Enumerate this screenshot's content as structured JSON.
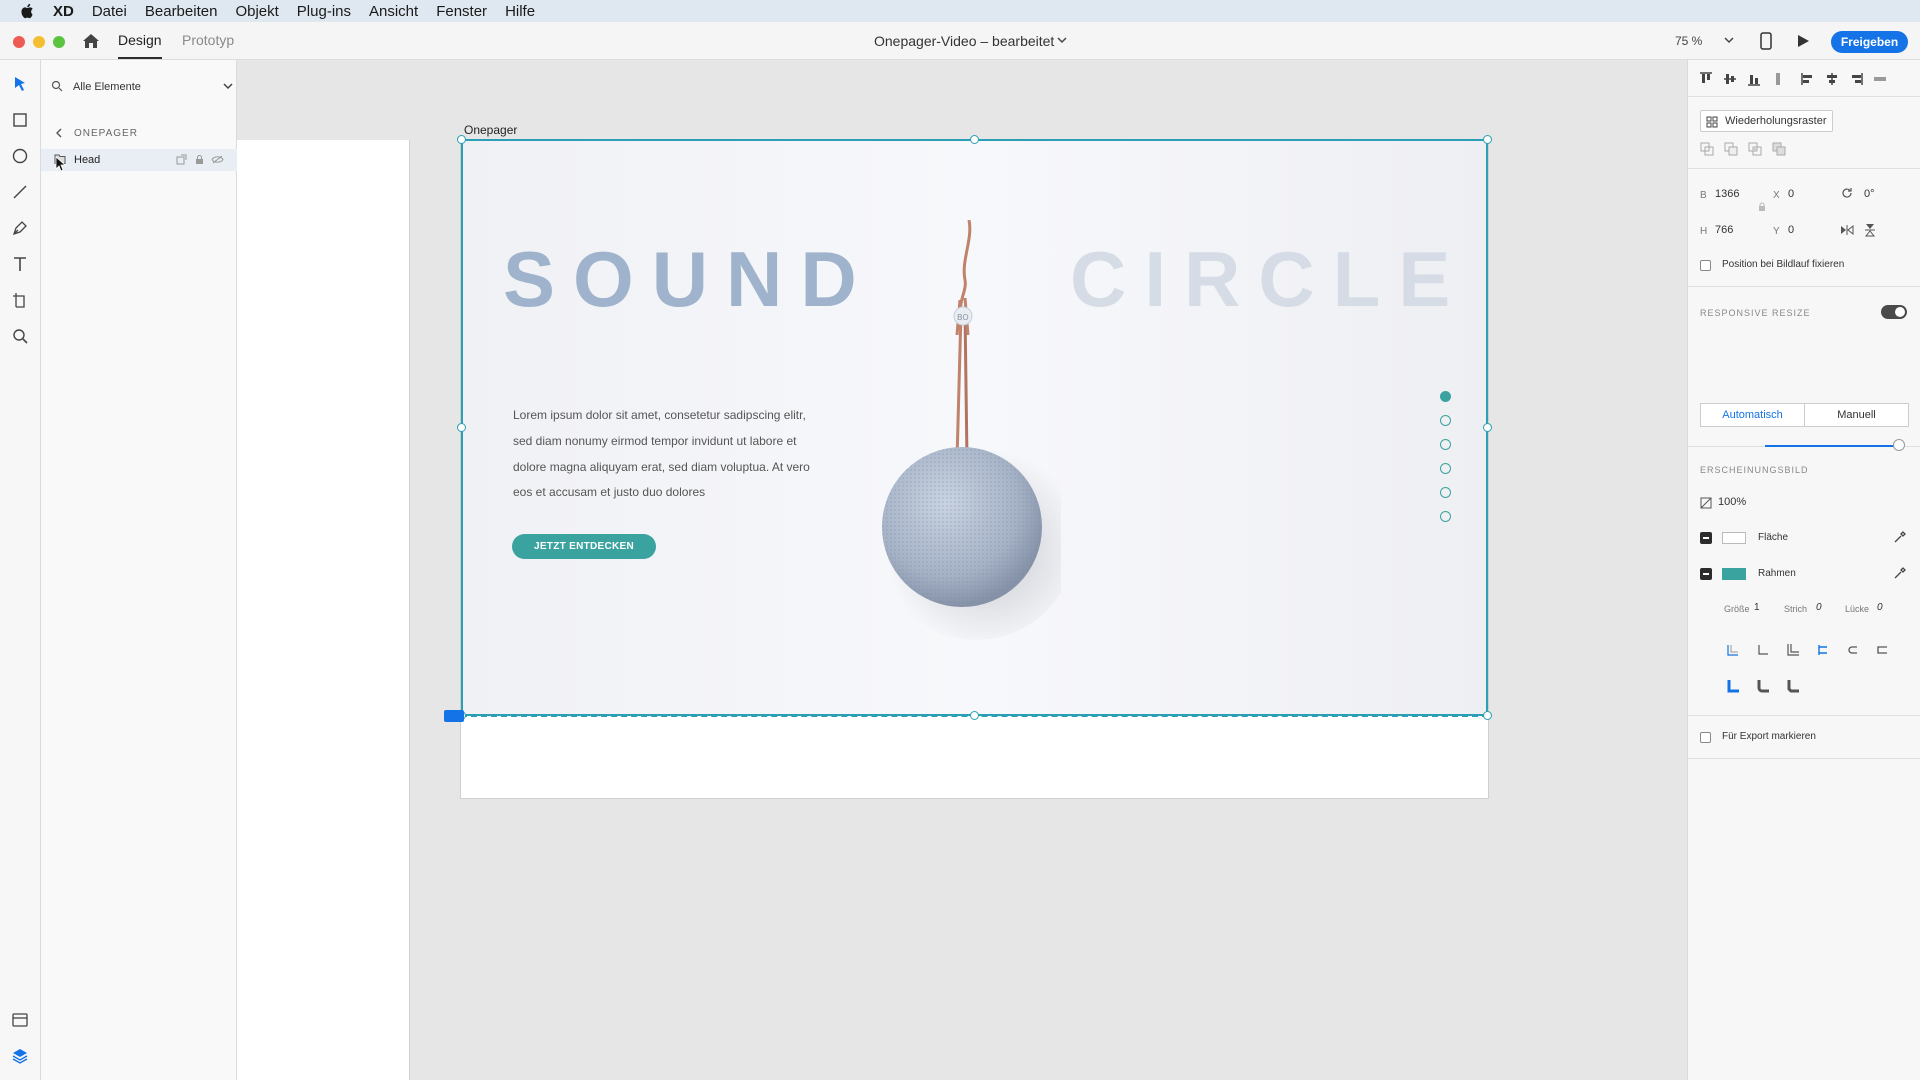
{
  "menubar": {
    "items": [
      "XD",
      "Datei",
      "Bearbeiten",
      "Objekt",
      "Plug-ins",
      "Ansicht",
      "Fenster",
      "Hilfe"
    ]
  },
  "titlebar": {
    "tabs": [
      "Design",
      "Prototyp"
    ],
    "document_title": "Onepager-Video – bearbeitet",
    "zoom": "75 %",
    "share_label": "Freigeben"
  },
  "layers": {
    "search_label": "Alle Elemente",
    "breadcrumb": "ONEPAGER",
    "items": [
      {
        "name": "Head"
      }
    ]
  },
  "canvas": {
    "artboard_name": "Onepager",
    "hero": {
      "title_left": "SOUND",
      "title_right": "CIRCLE",
      "body": "Lorem ipsum dolor sit amet, consetetur sadipscing elitr, sed diam nonumy eirmod tempor invidunt ut labore et dolore magna aliquyam erat, sed diam voluptua. At vero eos et accusam et justo duo dolores",
      "cta_label": "JETZT ENTDECKEN",
      "slider_dots": 6,
      "active_dot": 0
    }
  },
  "properties": {
    "repeat_grid_label": "Wiederholungsraster",
    "width_label": "B",
    "width_value": "1366",
    "height_label": "H",
    "height_value": "766",
    "x_label": "X",
    "x_value": "0",
    "y_label": "Y",
    "y_value": "0",
    "rotation_value": "0°",
    "fix_position_label": "Position bei Bildlauf fixieren",
    "responsive_resize_label": "RESPONSIVE RESIZE",
    "responsive_resize_on": true,
    "resize_modes": [
      "Automatisch",
      "Manuell"
    ],
    "appearance_label": "ERSCHEINUNGSBILD",
    "opacity_value": "100%",
    "fill_label": "Fläche",
    "border_label": "Rahmen",
    "size_label": "Größe",
    "size_value": "1",
    "dash_label": "Strich",
    "dash_value": "0",
    "gap_label": "Lücke",
    "gap_value": "0",
    "export_label": "Für Export markieren"
  },
  "colors": {
    "accent": "#3aa3a0",
    "selection": "#2a9fb5",
    "primary_button": "#1473e6",
    "title_left": "#9fb4cc",
    "title_right": "#d6dce5",
    "border_swatch": "#3aa3a0"
  }
}
